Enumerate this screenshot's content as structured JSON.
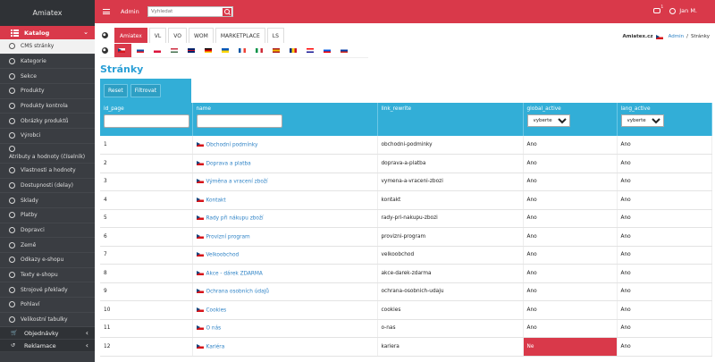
{
  "sidebar": {
    "brand": "Amiatex",
    "section": "Katalog",
    "items": [
      {
        "label": "CMS stránky",
        "active": true
      },
      {
        "label": "Kategorie"
      },
      {
        "label": "Sekce"
      },
      {
        "label": "Produkty"
      },
      {
        "label": "Produkty kontrola"
      },
      {
        "label": "Obrázky produktů"
      },
      {
        "label": "Výrobci"
      },
      {
        "label": "Atributy a hodnoty (číselník)",
        "tall": true
      },
      {
        "label": "Vlastnosti a hodnoty"
      },
      {
        "label": "Dostupnosti (delay)"
      },
      {
        "label": "Sklady"
      },
      {
        "label": "Platby"
      },
      {
        "label": "Dopravci"
      },
      {
        "label": "Země"
      },
      {
        "label": "Odkazy e-shopu"
      },
      {
        "label": "Texty e-shopu"
      },
      {
        "label": "Strojové překlady"
      },
      {
        "label": "Pohlaví"
      },
      {
        "label": "Velikostní tabulky"
      }
    ],
    "footer": [
      {
        "label": "Objednávky"
      },
      {
        "label": "Reklamace"
      }
    ]
  },
  "topbar": {
    "admin_label": "Admin",
    "search_placeholder": "Vyhledat",
    "message_count": "1",
    "user": "Jan M."
  },
  "tabs": [
    {
      "label": "Amiatex",
      "active": true
    },
    {
      "label": "VL"
    },
    {
      "label": "VO"
    },
    {
      "label": "WOM"
    },
    {
      "label": "MARKETPLACE"
    },
    {
      "label": "LS"
    }
  ],
  "flags": [
    {
      "code": "cz",
      "active": true
    },
    {
      "code": "sk"
    },
    {
      "code": "pl"
    },
    {
      "code": "hu"
    },
    {
      "code": "gb"
    },
    {
      "code": "de"
    },
    {
      "code": "ua"
    },
    {
      "code": "fr"
    },
    {
      "code": "it"
    },
    {
      "code": "es"
    },
    {
      "code": "ro"
    },
    {
      "code": "hr"
    },
    {
      "code": "si"
    },
    {
      "code": "ru"
    }
  ],
  "breadcrumb": {
    "site": "Amiatex.cz",
    "admin": "Admin",
    "current": "Stránky"
  },
  "page_title": "Stránky",
  "filter": {
    "reset_label": "Reset",
    "filter_label": "Filtrovat"
  },
  "table": {
    "columns": [
      "id_page",
      "name",
      "link_rewrite",
      "global_active",
      "lang_active"
    ],
    "select_label": "vyberte",
    "rows": [
      {
        "id": "1",
        "name": "Obchodní podmínky",
        "link": "obchodni-podminky",
        "global": "Ano",
        "lang": "Ano"
      },
      {
        "id": "2",
        "name": "Doprava a platba",
        "link": "doprava-a-platba",
        "global": "Ano",
        "lang": "Ano"
      },
      {
        "id": "3",
        "name": "Výměna a vracení zboží",
        "link": "vymena-a-vraceni-zbozi",
        "global": "Ano",
        "lang": "Ano"
      },
      {
        "id": "4",
        "name": "Kontakt",
        "link": "kontakt",
        "global": "Ano",
        "lang": "Ano"
      },
      {
        "id": "5",
        "name": "Rady při nákupu zboží",
        "link": "rady-pri-nakupu-zbozi",
        "global": "Ano",
        "lang": "Ano"
      },
      {
        "id": "6",
        "name": "Provizní program",
        "link": "provizni-program",
        "global": "Ano",
        "lang": "Ano"
      },
      {
        "id": "7",
        "name": "Velkoobchod",
        "link": "velkoobchod",
        "global": "Ano",
        "lang": "Ano"
      },
      {
        "id": "8",
        "name": "Akce - dárek ZDARMA",
        "link": "akce-darek-zdarma",
        "global": "Ano",
        "lang": "Ano"
      },
      {
        "id": "9",
        "name": "Ochrana osobních údajů",
        "link": "ochrana-osobnich-udaju",
        "global": "Ano",
        "lang": "Ano"
      },
      {
        "id": "10",
        "name": "Cookies",
        "link": "cookies",
        "global": "Ano",
        "lang": "Ano"
      },
      {
        "id": "11",
        "name": "O nás",
        "link": "o-nas",
        "global": "Ano",
        "lang": "Ano"
      },
      {
        "id": "12",
        "name": "Kariéra",
        "link": "kariera",
        "global": "Ne",
        "lang": "Ano",
        "global_warn": true
      }
    ]
  },
  "colors": {
    "accent": "#d9394a",
    "header_blue": "#32aed7",
    "link_blue": "#2f83c6",
    "sidebar_bg": "#3a3d42"
  }
}
